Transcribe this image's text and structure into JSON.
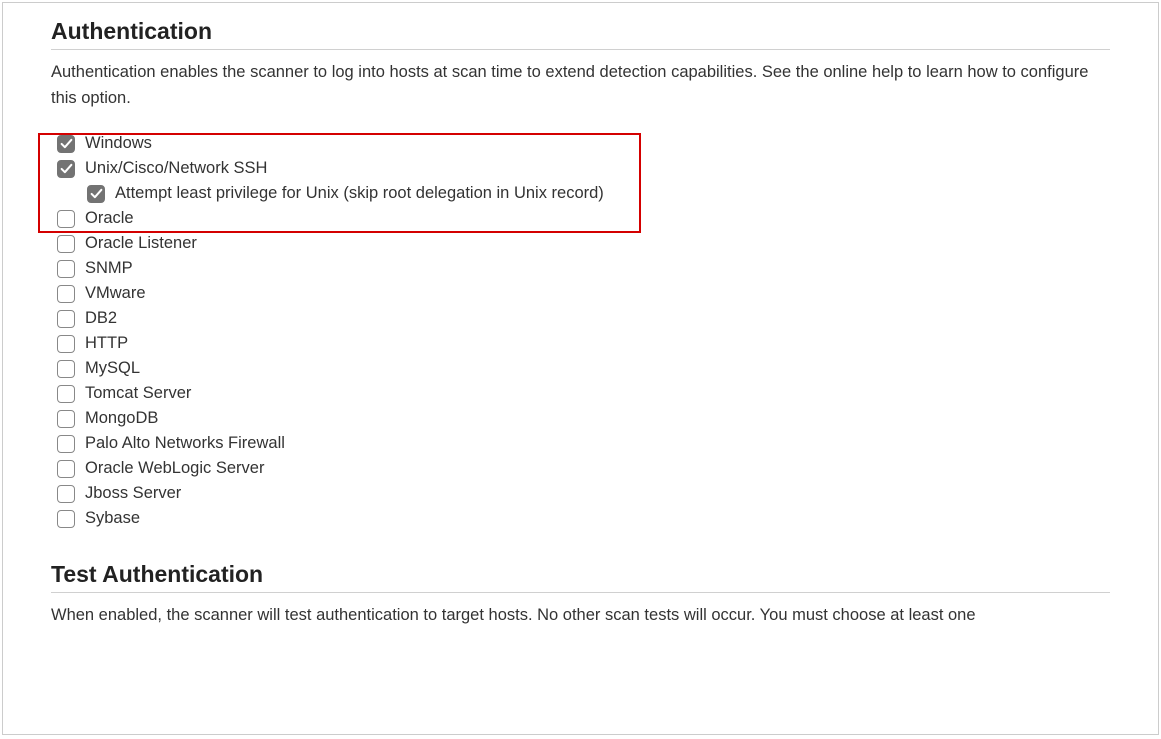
{
  "authentication": {
    "title": "Authentication",
    "description": "Authentication enables the scanner to log into hosts at scan time to extend detection capabilities. See the online help to learn how to configure this option.",
    "items": [
      {
        "label": "Windows",
        "checked": true,
        "sub": false
      },
      {
        "label": "Unix/Cisco/Network SSH",
        "checked": true,
        "sub": false
      },
      {
        "label": "Attempt least privilege for Unix (skip root delegation in Unix record)",
        "checked": true,
        "sub": true
      },
      {
        "label": "Oracle",
        "checked": false,
        "sub": false
      },
      {
        "label": "Oracle Listener",
        "checked": false,
        "sub": false
      },
      {
        "label": "SNMP",
        "checked": false,
        "sub": false
      },
      {
        "label": "VMware",
        "checked": false,
        "sub": false
      },
      {
        "label": "DB2",
        "checked": false,
        "sub": false
      },
      {
        "label": "HTTP",
        "checked": false,
        "sub": false
      },
      {
        "label": "MySQL",
        "checked": false,
        "sub": false
      },
      {
        "label": "Tomcat Server",
        "checked": false,
        "sub": false
      },
      {
        "label": "MongoDB",
        "checked": false,
        "sub": false
      },
      {
        "label": "Palo Alto Networks Firewall",
        "checked": false,
        "sub": false
      },
      {
        "label": "Oracle WebLogic Server",
        "checked": false,
        "sub": false
      },
      {
        "label": "Jboss Server",
        "checked": false,
        "sub": false
      },
      {
        "label": "Sybase",
        "checked": false,
        "sub": false
      }
    ]
  },
  "test_authentication": {
    "title": "Test Authentication",
    "description": "When enabled, the scanner will test authentication to target hosts. No other scan tests will occur. You must choose at least one"
  }
}
